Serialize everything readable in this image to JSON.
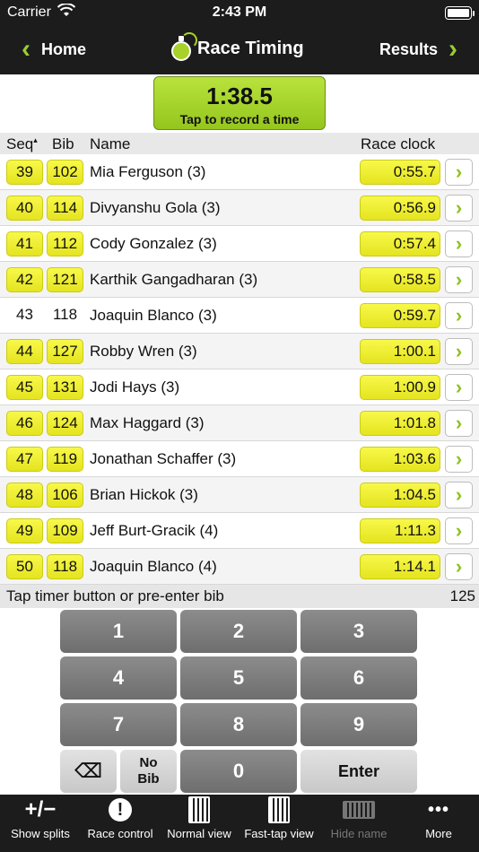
{
  "status": {
    "carrier": "Carrier",
    "time": "2:43 PM"
  },
  "nav": {
    "back_label": "Home",
    "title": "Race Timing",
    "forward_label": "Results"
  },
  "timer": {
    "time": "1:38.5",
    "hint": "Tap to record a time"
  },
  "table": {
    "headers": {
      "seq": "Seq",
      "sort_marker": "▴",
      "bib": "Bib",
      "name": "Name",
      "clock": "Race clock"
    },
    "rows": [
      {
        "seq": "39",
        "bib": "102",
        "name": "Mia Ferguson (3)",
        "clock": "0:55.7",
        "chip": true
      },
      {
        "seq": "40",
        "bib": "114",
        "name": "Divyanshu Gola (3)",
        "clock": "0:56.9",
        "chip": true
      },
      {
        "seq": "41",
        "bib": "112",
        "name": "Cody Gonzalez (3)",
        "clock": "0:57.4",
        "chip": true
      },
      {
        "seq": "42",
        "bib": "121",
        "name": "Karthik Gangadharan (3)",
        "clock": "0:58.5",
        "chip": true
      },
      {
        "seq": "43",
        "bib": "118",
        "name": "Joaquin Blanco (3)",
        "clock": "0:59.7",
        "chip": false
      },
      {
        "seq": "44",
        "bib": "127",
        "name": "Robby Wren (3)",
        "clock": "1:00.1",
        "chip": true
      },
      {
        "seq": "45",
        "bib": "131",
        "name": "Jodi Hays (3)",
        "clock": "1:00.9",
        "chip": true
      },
      {
        "seq": "46",
        "bib": "124",
        "name": "Max Haggard (3)",
        "clock": "1:01.8",
        "chip": true
      },
      {
        "seq": "47",
        "bib": "119",
        "name": "Jonathan Schaffer (3)",
        "clock": "1:03.6",
        "chip": true
      },
      {
        "seq": "48",
        "bib": "106",
        "name": "Brian Hickok (3)",
        "clock": "1:04.5",
        "chip": true
      },
      {
        "seq": "49",
        "bib": "109",
        "name": "Jeff Burt-Gracik (4)",
        "clock": "1:11.3",
        "chip": true
      },
      {
        "seq": "50",
        "bib": "118",
        "name": "Joaquin Blanco (4)",
        "clock": "1:14.1",
        "chip": true
      }
    ]
  },
  "hint_bar": {
    "text": "Tap timer button or pre-enter bib",
    "count": "125"
  },
  "keypad": {
    "k1": "1",
    "k2": "2",
    "k3": "3",
    "k4": "4",
    "k5": "5",
    "k6": "6",
    "k7": "7",
    "k8": "8",
    "k9": "9",
    "backspace": "⌫",
    "nobib_line1": "No",
    "nobib_line2": "Bib",
    "k0": "0",
    "enter": "Enter"
  },
  "tabs": {
    "show_splits": "Show splits",
    "show_splits_icon": "+/−",
    "race_control": "Race control",
    "race_control_icon": "!",
    "normal_view": "Normal view",
    "fast_tap_view": "Fast-tap view",
    "hide_name": "Hide name",
    "more": "More",
    "more_icon": "•••"
  },
  "colors": {
    "accent": "#9acd32",
    "chip": "#f0f040",
    "bar": "#1c1c1c"
  }
}
